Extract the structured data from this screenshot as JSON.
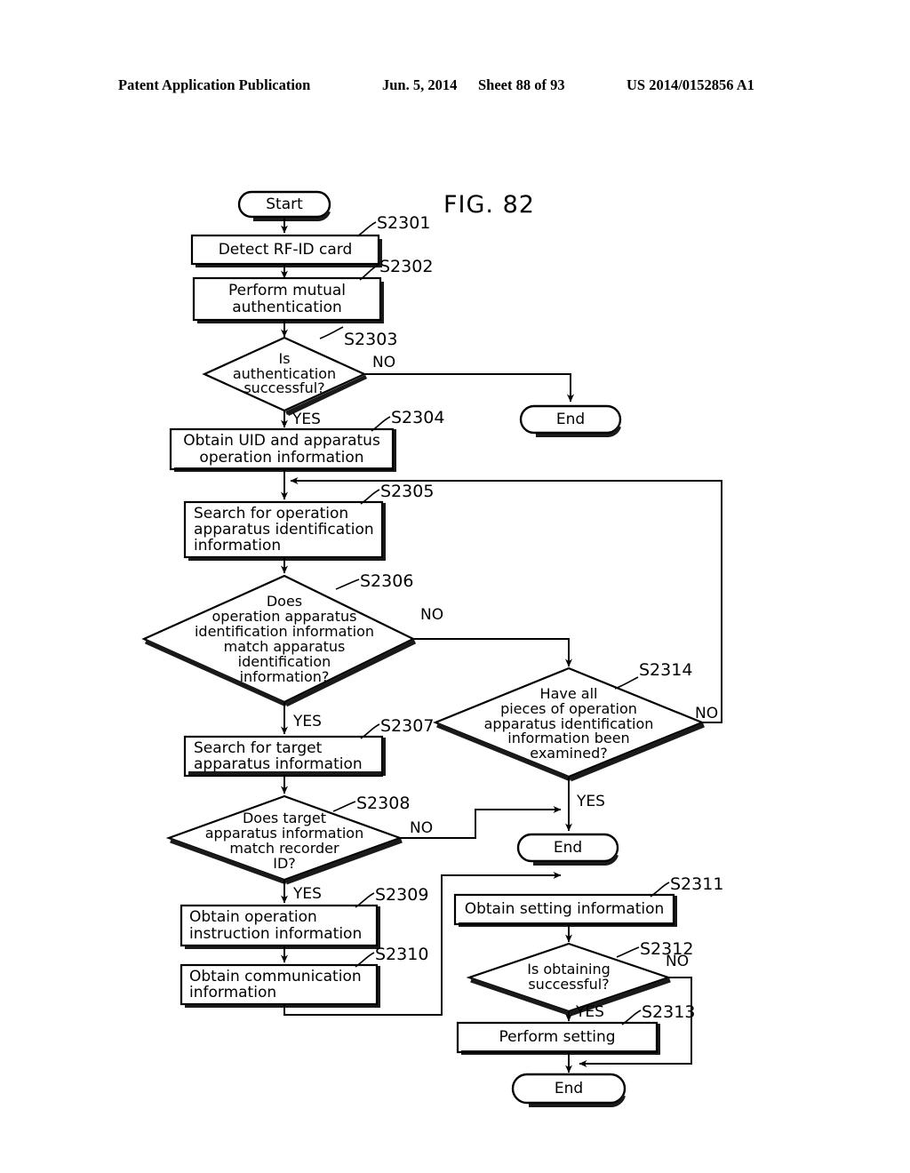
{
  "header": {
    "publication": "Patent Application Publication",
    "date": "Jun. 5, 2014",
    "sheet": "Sheet 88 of 93",
    "number": "US 2014/0152856 A1"
  },
  "figure": {
    "label": "FIG. 82"
  },
  "flowchart": {
    "nodes": {
      "start": {
        "text": "Start",
        "type": "terminator"
      },
      "s2301": {
        "text": "Detect RF-ID card",
        "type": "process",
        "tag": "S2301"
      },
      "s2302": {
        "text": "Perform mutual\nauthentication",
        "type": "process",
        "tag": "S2302"
      },
      "s2303": {
        "text": "Is\nauthentication\nsuccessful?",
        "type": "decision",
        "tag": "S2303"
      },
      "end_a": {
        "text": "End",
        "type": "terminator"
      },
      "s2304": {
        "text": "Obtain UID and apparatus\noperation information",
        "type": "process",
        "tag": "S2304"
      },
      "s2305": {
        "text": "Search for operation\napparatus identification\ninformation",
        "type": "process",
        "tag": "S2305"
      },
      "s2306": {
        "text": "Does\noperation apparatus\nidentification information\nmatch apparatus\nidentification\ninformation?",
        "type": "decision",
        "tag": "S2306"
      },
      "s2314": {
        "text": "Have all\npieces of operation\napparatus identification\ninformation been\nexamined?",
        "type": "decision",
        "tag": "S2314"
      },
      "s2307": {
        "text": "Search for target\napparatus information",
        "type": "process",
        "tag": "S2307"
      },
      "s2308": {
        "text": "Does target\napparatus information\nmatch recorder\nID?",
        "type": "decision",
        "tag": "S2308"
      },
      "end_b": {
        "text": "End",
        "type": "terminator"
      },
      "s2309": {
        "text": "Obtain operation\ninstruction information",
        "type": "process",
        "tag": "S2309"
      },
      "s2310": {
        "text": "Obtain communication\ninformation",
        "type": "process",
        "tag": "S2310"
      },
      "s2311": {
        "text": "Obtain setting information",
        "type": "process",
        "tag": "S2311"
      },
      "s2312": {
        "text": "Is obtaining\nsuccessful?",
        "type": "decision",
        "tag": "S2312"
      },
      "s2313": {
        "text": "Perform setting",
        "type": "process",
        "tag": "S2313"
      },
      "end_c": {
        "text": "End",
        "type": "terminator"
      }
    },
    "branch_labels": {
      "s2303_no": "NO",
      "s2303_yes": "YES",
      "s2306_no": "NO",
      "s2306_yes": "YES",
      "s2314_no": "NO",
      "s2314_yes": "YES",
      "s2308_no": "NO",
      "s2308_yes": "YES",
      "s2312_no": "NO",
      "s2312_yes": "YES"
    }
  },
  "colors": {
    "ink": "#000000",
    "paper": "#ffffff"
  }
}
